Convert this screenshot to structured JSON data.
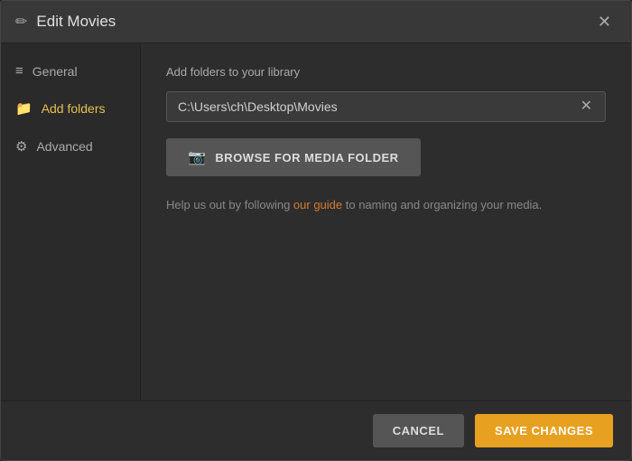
{
  "modal": {
    "title": "Edit Movies",
    "title_icon": "✏",
    "close_icon": "✕"
  },
  "sidebar": {
    "items": [
      {
        "id": "general",
        "label": "General",
        "icon": "≡",
        "active": false
      },
      {
        "id": "add-folders",
        "label": "Add folders",
        "icon": "📁",
        "active": true
      },
      {
        "id": "advanced",
        "label": "Advanced",
        "icon": "⚙",
        "active": false
      }
    ]
  },
  "content": {
    "section_label": "Add folders to your library",
    "folder_path": "C:\\Users\\ch\\Desktop\\Movies",
    "clear_icon": "✕",
    "browse_button_label": "BROWSE FOR MEDIA FOLDER",
    "browse_icon": "📷",
    "help_text_before": "Help us out by following ",
    "help_link_text": "our guide",
    "help_text_after": " to naming and organizing your media."
  },
  "footer": {
    "cancel_label": "CANCEL",
    "save_label": "SAVE CHANGES"
  }
}
